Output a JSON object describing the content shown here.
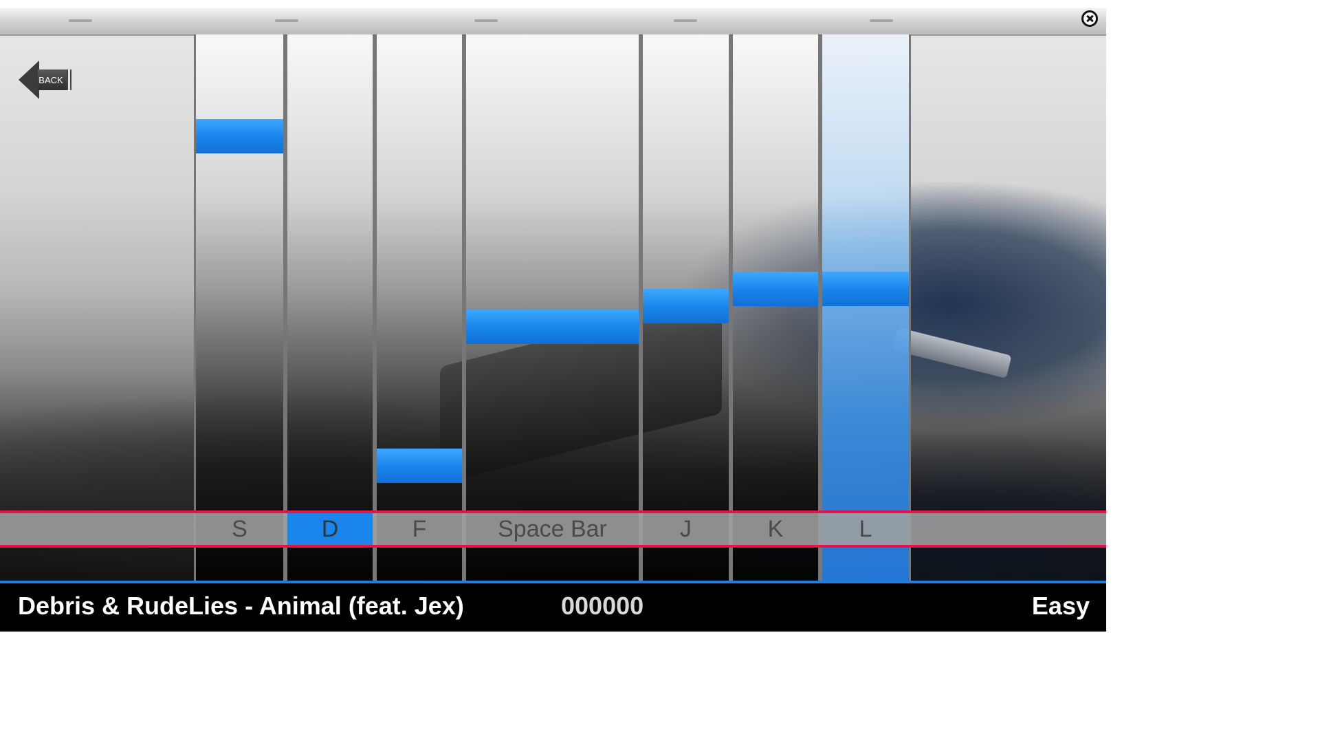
{
  "window": {
    "close_icon": "close-circle-icon"
  },
  "back_button": {
    "label": "BACK",
    "icon": "back-arrow-icon"
  },
  "lanes": [
    {
      "key": "S",
      "pressed": false,
      "glow": false
    },
    {
      "key": "D",
      "pressed": true,
      "glow": false
    },
    {
      "key": "F",
      "pressed": false,
      "glow": false
    },
    {
      "key": "Space Bar",
      "pressed": false,
      "glow": false
    },
    {
      "key": "J",
      "pressed": false,
      "glow": false
    },
    {
      "key": "K",
      "pressed": false,
      "glow": false
    },
    {
      "key": "L",
      "pressed": false,
      "glow": true
    }
  ],
  "info_bar": {
    "song": "Debris & RudeLies - Animal (feat. Jex)",
    "score": "000000",
    "difficulty": "Easy"
  },
  "colors": {
    "note": "#1a86ec",
    "hit_line": "#e0154a",
    "info_bar_accent": "#1e7fe0"
  }
}
